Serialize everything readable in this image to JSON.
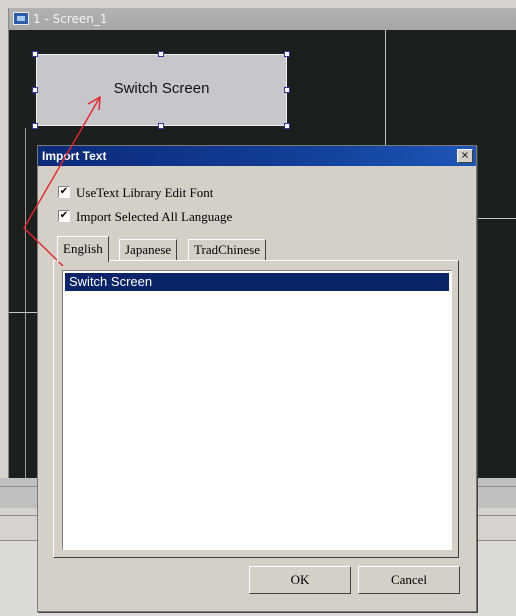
{
  "editor": {
    "window_title": "1 - Screen_1",
    "object_label": "Switch Screen"
  },
  "dialog": {
    "title": "Import Text",
    "close_label": "×",
    "options": [
      {
        "label": "UseText Library Edit Font",
        "checked": true
      },
      {
        "label": "Import  Selected All Language",
        "checked": true
      }
    ],
    "tabs": [
      {
        "label": "English",
        "active": true
      },
      {
        "label": "Japanese",
        "active": false
      },
      {
        "label": "TradChinese",
        "active": false
      }
    ],
    "list_items": [
      "Switch Screen"
    ],
    "selected_item": "Switch Screen",
    "ok_label": "OK",
    "cancel_label": "Cancel"
  },
  "colors": {
    "canvas": "#1b1f1d",
    "dialog_title_bar": "#0b2a78",
    "selection": "#0a246a",
    "arrow": "#e8242a"
  },
  "check_mark": "✔"
}
